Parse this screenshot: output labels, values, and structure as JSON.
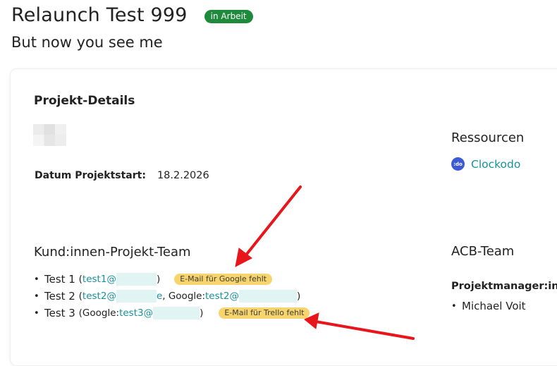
{
  "header": {
    "title": "Relaunch Test 999",
    "status": "in Arbeit",
    "subtitle": "But now you see me"
  },
  "details": {
    "section_title": "Projekt-Details",
    "start_label": "Datum Projektstart:",
    "start_value": "18.2.2026"
  },
  "resources": {
    "heading": "Ressourcen",
    "items": [
      {
        "icon": "clockodo-logo-icon",
        "icon_text": ":do",
        "label": "Clockodo"
      }
    ]
  },
  "client_team": {
    "heading": "Kund:innen-Projekt-Team",
    "members": [
      {
        "name": "Test 1",
        "open": "(",
        "email_visible": "test1@",
        "close": ")",
        "badge": "E-Mail für Google fehlt"
      },
      {
        "name": "Test 2",
        "open": "(",
        "email_visible": "test2@",
        "email_tail": "e",
        "google_label": ", Google: ",
        "google_email_visible": "test2@",
        "close": ")"
      },
      {
        "name": "Test 3",
        "open": "(Google: ",
        "google_email_visible": "test3@",
        "close": ")",
        "badge": "E-Mail für Trello fehlt"
      }
    ]
  },
  "acb_team": {
    "heading": "ACB-Team",
    "role_label": "Projektmanager:in",
    "members": [
      "Michael Voit"
    ]
  },
  "colors": {
    "status_badge": "#1e8a3c",
    "warning_badge": "#f8d56c",
    "link": "#16929a",
    "annotation_arrow": "#e8151b"
  }
}
